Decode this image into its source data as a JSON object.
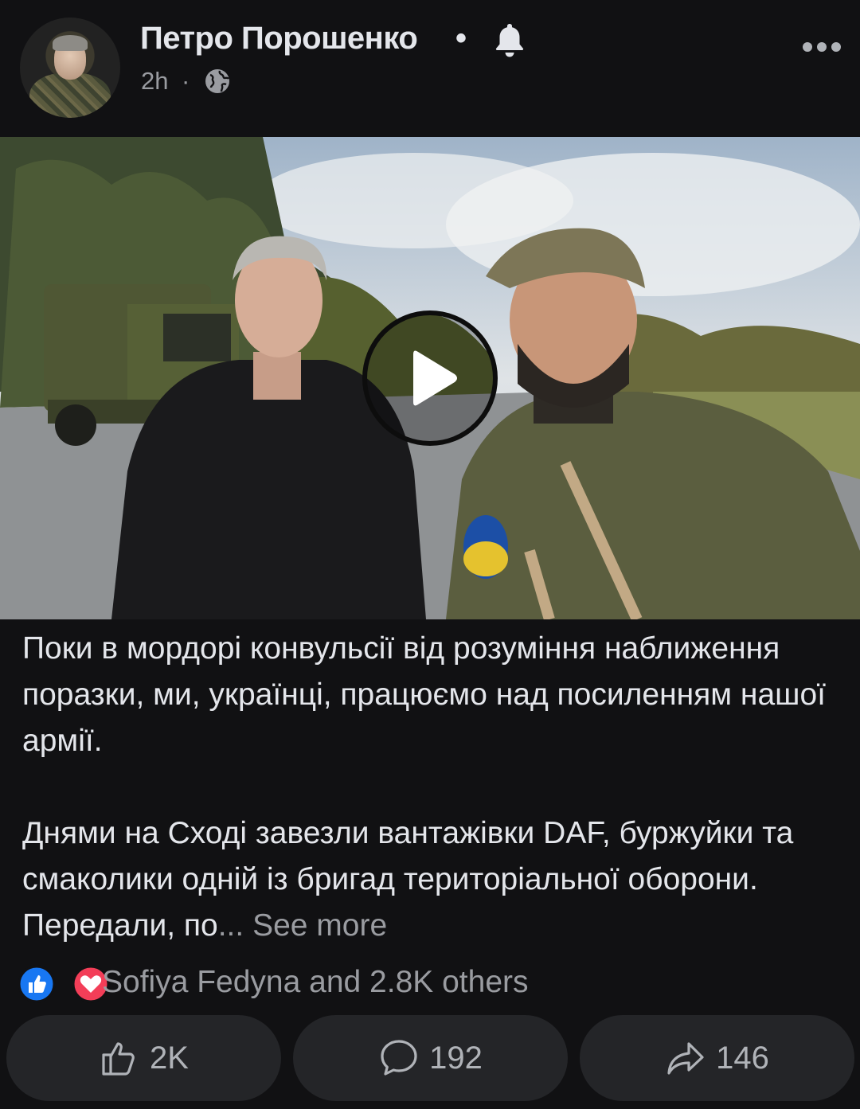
{
  "header": {
    "author": "Петро Порошенко",
    "separator": "•",
    "time": "2h",
    "time_separator": "·",
    "icons": {
      "follow": "bell-icon",
      "privacy": "globe-icon",
      "menu": "more-horizontal-icon"
    }
  },
  "video": {
    "play_icon": "play-icon"
  },
  "post": {
    "paragraph_1": "Поки в мордорі конвульсії від розуміння наближення поразки, ми, українці, працюємо над посиленням нашої армії.",
    "paragraph_2": "Днями на Сході завезли вантажівки DAF, буржуйки та смаколики одній із бригад територіальної оборони. Передали, по",
    "ellipsis": "...",
    "see_more": "See more"
  },
  "reactions": {
    "summary": "Sofiya Fedyna and 2.8K others",
    "types": [
      "like-icon",
      "love-icon"
    ],
    "colors": {
      "like": "#1877f2",
      "love": "#f33e58"
    }
  },
  "actions": {
    "like_count": "2K",
    "comment_count": "192",
    "share_count": "146"
  },
  "colors": {
    "background": "#111113",
    "text": "#e4e6eb",
    "secondary_text": "#9a9ca1",
    "button_bg": "#242528"
  }
}
